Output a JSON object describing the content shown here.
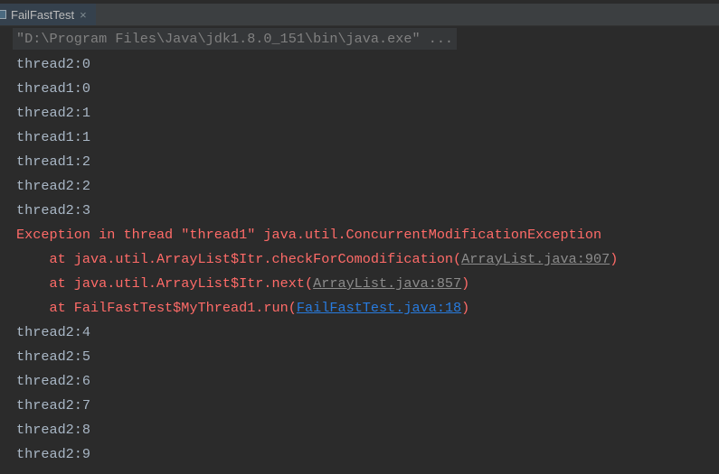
{
  "tab": {
    "title": "FailFastTest",
    "close": "×",
    "icon": "console-icon"
  },
  "command": "\"D:\\Program Files\\Java\\jdk1.8.0_151\\bin\\java.exe\" ...",
  "output_before": [
    "thread2:0",
    "thread1:0",
    "thread2:1",
    "thread1:1",
    "thread1:2",
    "thread2:2",
    "thread2:3"
  ],
  "exception": {
    "header": "Exception in thread \"thread1\" java.util.ConcurrentModificationException",
    "frames": [
      {
        "prefix": "    at java.util.ArrayList$Itr.checkForComodification(",
        "link": "ArrayList.java:907",
        "suffix": ")",
        "link_style": "gray"
      },
      {
        "prefix": "    at java.util.ArrayList$Itr.next(",
        "link": "ArrayList.java:857",
        "suffix": ")",
        "link_style": "gray"
      },
      {
        "prefix": "    at FailFastTest$MyThread1.run(",
        "link": "FailFastTest.java:18",
        "suffix": ")",
        "link_style": "blue"
      }
    ]
  },
  "output_after": [
    "thread2:4",
    "thread2:5",
    "thread2:6",
    "thread2:7",
    "thread2:8",
    "thread2:9"
  ],
  "colors": {
    "background": "#2b2b2b",
    "text": "#a9b7c6",
    "error": "#ff6b68",
    "link_gray": "#8c8c8c",
    "link_blue": "#287bde"
  }
}
